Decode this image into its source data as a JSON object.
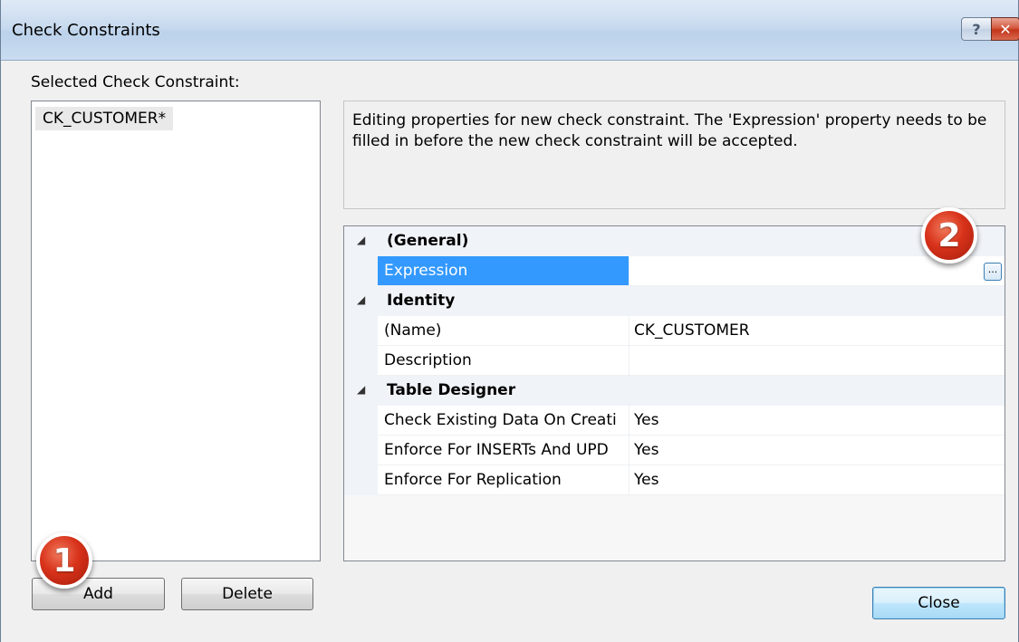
{
  "window": {
    "title": "Check Constraints",
    "help_glyph": "?",
    "close_glyph": "✕"
  },
  "left_panel": {
    "label": "Selected Check Constraint:",
    "items": [
      "CK_CUSTOMER*"
    ]
  },
  "description": "Editing properties for new check constraint.  The 'Expression' property needs to be filled in before the new check constraint will be accepted.",
  "property_grid": {
    "categories": [
      {
        "label": "(General)",
        "rows": [
          {
            "name": "Expression",
            "value": "",
            "selected": true,
            "has_ellipsis": true,
            "ellipsis": "..."
          }
        ]
      },
      {
        "label": "Identity",
        "rows": [
          {
            "name": "(Name)",
            "value": "CK_CUSTOMER"
          },
          {
            "name": "Description",
            "value": ""
          }
        ]
      },
      {
        "label": "Table Designer",
        "rows": [
          {
            "name": "Check Existing Data On Creati",
            "value": "Yes"
          },
          {
            "name": "Enforce For INSERTs And UPD",
            "value": "Yes"
          },
          {
            "name": "Enforce For Replication",
            "value": "Yes"
          }
        ]
      }
    ],
    "collapse_arrow": "◢"
  },
  "buttons": {
    "add": "Add",
    "delete": "Delete",
    "close": "Close"
  },
  "callouts": {
    "one": "1",
    "two": "2"
  },
  "colors": {
    "selection": "#3399ff",
    "callout": "#d8321a"
  }
}
